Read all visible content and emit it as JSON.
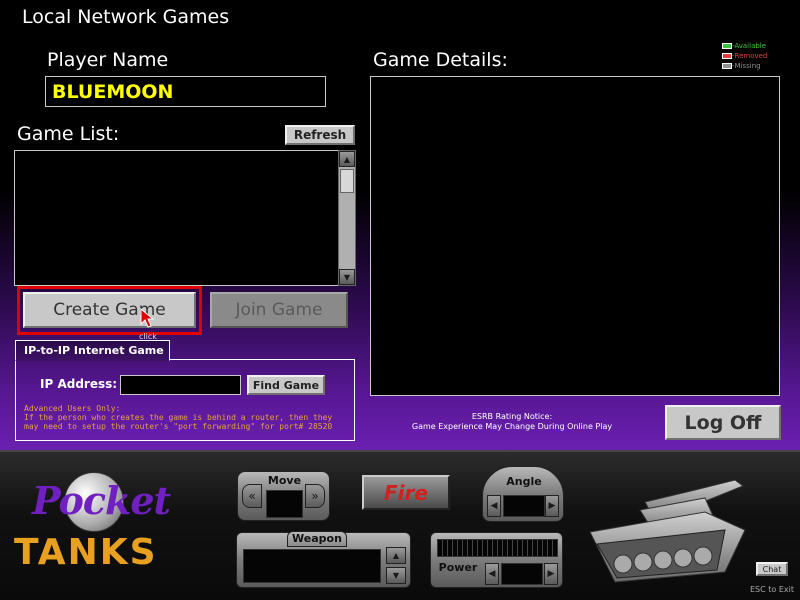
{
  "screen": {
    "title": "Local Network Games"
  },
  "player": {
    "label": "Player Name",
    "value": "BLUEMOON"
  },
  "game_list": {
    "label": "Game List:",
    "refresh_label": "Refresh",
    "items": []
  },
  "game_details": {
    "label": "Game Details:"
  },
  "legend": {
    "available": "-Available",
    "removed": "-Removed",
    "missing": "-Missing",
    "colors": {
      "available": "#40c040",
      "removed": "#e04040",
      "missing": "#909090"
    }
  },
  "buttons": {
    "create_game": "Create Game",
    "join_game": "Join Game",
    "click_hint": "click",
    "log_off": "Log Off"
  },
  "ip_game": {
    "tab_label": "IP-to-IP Internet Game",
    "ip_label": "IP Address:",
    "ip_value": "",
    "find_game": "Find Game",
    "advanced_heading": "Advanced Users Only:",
    "advanced_text": "If the person who creates the game is behind a router, then they may need to setup the router's \"port forwarding\" for port# 28520"
  },
  "esrb": {
    "heading": "ESRB Rating Notice:",
    "text": "Game Experience May Change During Online Play"
  },
  "dashboard": {
    "logo_top": "Pocket",
    "logo_bottom": "TANKS",
    "move_label": "Move",
    "fire_label": "Fire",
    "angle_label": "Angle",
    "weapon_label": "Weapon",
    "power_label": "Power",
    "chat_label": "Chat",
    "esc_hint": "ESC to Exit"
  },
  "colors": {
    "player_name": "#ffff00",
    "highlight_box": "#e00000",
    "fire_text": "#d02020",
    "advanced_text": "#e8a040"
  }
}
